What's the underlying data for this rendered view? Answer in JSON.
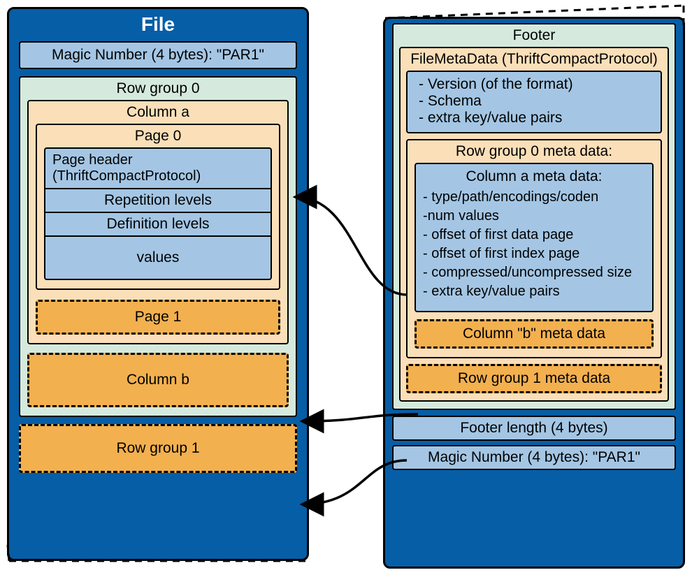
{
  "file": {
    "title": "File",
    "magic": "Magic Number (4 bytes): \"PAR1\"",
    "row_group0": {
      "label": "Row group 0",
      "column_a": {
        "label": "Column a",
        "page0": {
          "label": "Page 0",
          "header": "Page header (ThriftCompactProtocol)",
          "rep": "Repetition levels",
          "def": "Definition levels",
          "vals": "values"
        },
        "page1": "Page 1"
      },
      "column_b": "Column b"
    },
    "row_group1": "Row group 1"
  },
  "footer": {
    "title": "Footer",
    "fmd": {
      "label": "FileMetaData (ThriftCompactProtocol)",
      "info1": "- Version (of the format)",
      "info2": "- Schema",
      "info3": "- extra key/value pairs",
      "rg0": {
        "label": "Row group 0 meta data:",
        "col_a": {
          "label": "Column a meta data:",
          "l1": "- type/path/encodings/coden",
          "l2": "-num values",
          "l3": "- offset of first data page",
          "l4": "- offset of first index page",
          "l5": "- compressed/uncompressed size",
          "l6": "- extra key/value pairs"
        },
        "col_b": "Column \"b\" meta data"
      },
      "rg1": "Row group 1 meta data"
    },
    "len": "Footer length (4 bytes)",
    "magic": "Magic Number (4 bytes): \"PAR1\""
  }
}
